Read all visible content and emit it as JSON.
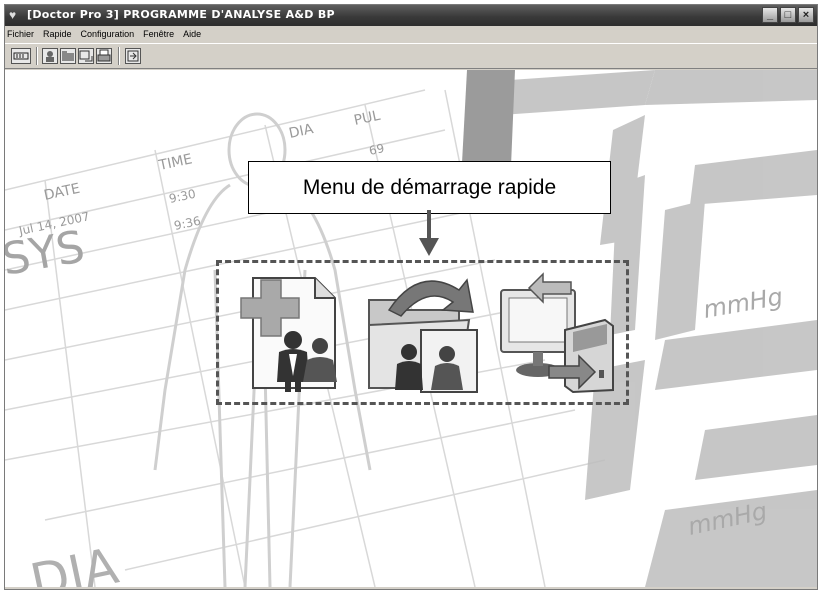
{
  "window": {
    "title": "[Doctor Pro 3] PROGRAMME D'ANALYSE A&D BP",
    "app_icon": "app-heart-icon",
    "controls": {
      "minimize": "_",
      "maximize": "□",
      "close": "×"
    }
  },
  "menu": {
    "items": [
      {
        "label": "Fichier"
      },
      {
        "label": "Rapide"
      },
      {
        "label": "Configuration"
      },
      {
        "label": "Fenêtre"
      },
      {
        "label": "Aide"
      }
    ]
  },
  "toolbar": {
    "buttons": [
      {
        "icon": "card-reader-icon"
      },
      {
        "icon": "new-patient-icon"
      },
      {
        "icon": "open-patient-icon"
      },
      {
        "icon": "transfer-icon"
      },
      {
        "icon": "print-icon"
      },
      {
        "icon": "exit-icon"
      }
    ]
  },
  "background": {
    "table_headers": [
      "DATE",
      "TIME",
      "DIA",
      "PUL"
    ],
    "table_rows": [
      [
        "Jul 14, 2007",
        "9:30",
        "",
        "69"
      ],
      [
        "",
        "9:36",
        "",
        ""
      ]
    ],
    "labels": {
      "sys": "SYS",
      "dia": "DIA",
      "unit_top": "mmHg",
      "unit_bottom": "mmHg"
    }
  },
  "callout": {
    "text": "Menu de démarrage rapide"
  },
  "quick_start": {
    "buttons": [
      {
        "name": "new-patient",
        "icon": "add-patient-icon"
      },
      {
        "name": "open-patient",
        "icon": "open-patient-folder-icon"
      },
      {
        "name": "data-transfer",
        "icon": "device-transfer-icon"
      }
    ]
  }
}
